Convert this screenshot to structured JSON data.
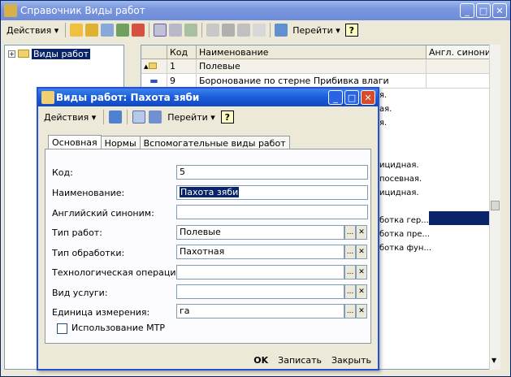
{
  "main_window": {
    "title": "Справочник Виды работ",
    "toolbar": {
      "actions_label": "Действия",
      "goto_label": "Перейти",
      "help_label": "?"
    }
  },
  "tree": {
    "root_label": "Виды работ"
  },
  "grid": {
    "headers": [
      "",
      "Код",
      "Наименование",
      "Англ. синоним"
    ],
    "rows": [
      [
        "",
        "1",
        "Полевые",
        ""
      ],
      [
        "",
        "9",
        "Боронование по стерне  Прибивка влаги",
        ""
      ]
    ]
  },
  "right_fragments": [
    "я.",
    "ая.",
    "я.",
    "ицидная.",
    "посевная.",
    "ицидная.",
    "ботка гер...",
    "ботка пре...",
    "ботка фун..."
  ],
  "dialog": {
    "title": "Виды работ: Пахота зяби",
    "toolbar": {
      "actions_label": "Действия",
      "goto_label": "Перейти",
      "help_label": "?"
    },
    "tabs": [
      "Основная",
      "Нормы",
      "Вспомогательные виды работ"
    ],
    "fields": {
      "code_label": "Код:",
      "code_value": "5",
      "name_label": "Наименование:",
      "name_value": "Пахота зяби",
      "english_label": "Английский синоним:",
      "english_value": "",
      "worktype_label": "Тип работ:",
      "worktype_value": "Полевые",
      "processing_label": "Тип обработки:",
      "processing_value": "Пахотная",
      "techop_label": "Технологическая операция:",
      "techop_value": "",
      "service_label": "Вид услуги:",
      "service_value": "",
      "unit_label": "Единица измерения:",
      "unit_value": "га",
      "mtr_label": "Использование МТР"
    },
    "footer": {
      "ok_label": "OK",
      "write_label": "Записать",
      "close_label": "Закрыть"
    }
  },
  "colors": {
    "title_gradient": "#7a96df",
    "dialog_title": "#1a5cd8",
    "selection": "#0a246a"
  }
}
